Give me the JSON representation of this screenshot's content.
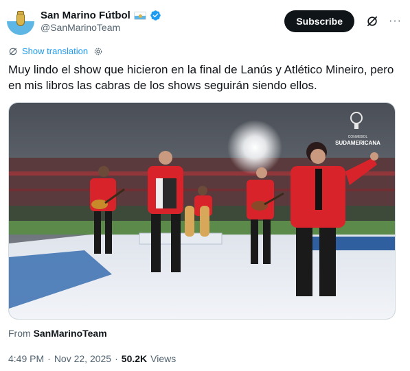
{
  "header": {
    "display_name": "San Marino Fútbol",
    "handle": "@SanMarinoTeam",
    "subscribe_label": "Subscribe",
    "more_icon": "more-dots-icon",
    "grok_icon": "grok-icon"
  },
  "translate": {
    "label": "Show translation"
  },
  "tweet": {
    "text": "Muy lindo el show que hicieron en la final de Lanús y Atlético Mineiro, pero en mis libros las cabras de los shows seguirán siendo ellos."
  },
  "media": {
    "watermark_top": "CONMEBOL",
    "watermark_brand": "SUDAMERICANA"
  },
  "from": {
    "prefix": "From",
    "account": "SanMarinoTeam"
  },
  "meta": {
    "time": "4:49 PM",
    "separator": "·",
    "date": "Nov 22, 2025",
    "views_count": "50.2K",
    "views_label": "Views"
  },
  "colors": {
    "accent": "#1d9bf0",
    "text": "#0f1419",
    "muted": "#536471",
    "jacket_red": "#d8232a"
  }
}
